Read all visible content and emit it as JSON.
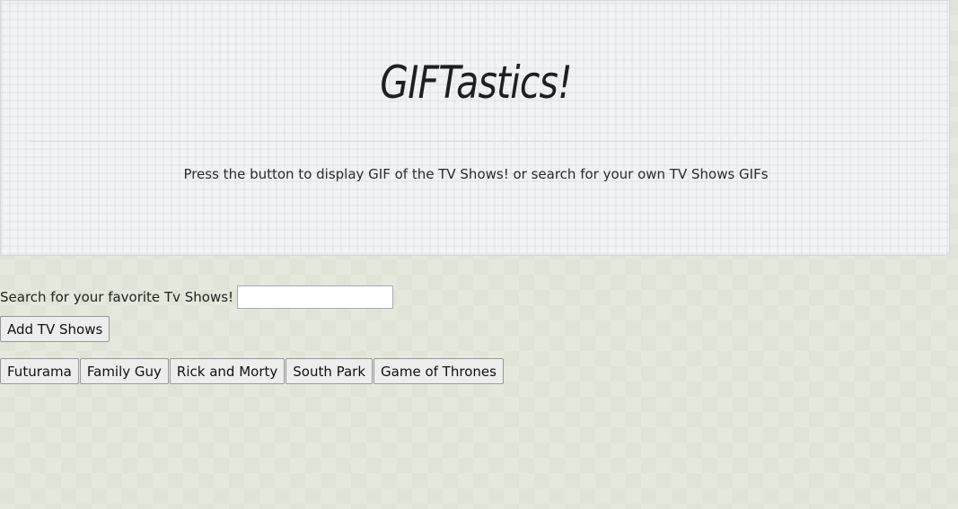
{
  "header": {
    "title": "GIFTastics!",
    "subtitle": "Press the button to display GIF of the TV Shows! or search for your own TV Shows GIFs"
  },
  "search": {
    "label": "Search for your favorite Tv Shows!",
    "value": "",
    "placeholder": ""
  },
  "add_button": {
    "label": "Add TV Shows"
  },
  "shows": [
    {
      "label": "Futurama"
    },
    {
      "label": "Family Guy"
    },
    {
      "label": "Rick and Morty"
    },
    {
      "label": "South Park"
    },
    {
      "label": "Game of Thrones"
    }
  ],
  "colors": {
    "page_background": "#dfe4d6",
    "header_background": "#f2f3f6",
    "button_background": "#ededed"
  }
}
